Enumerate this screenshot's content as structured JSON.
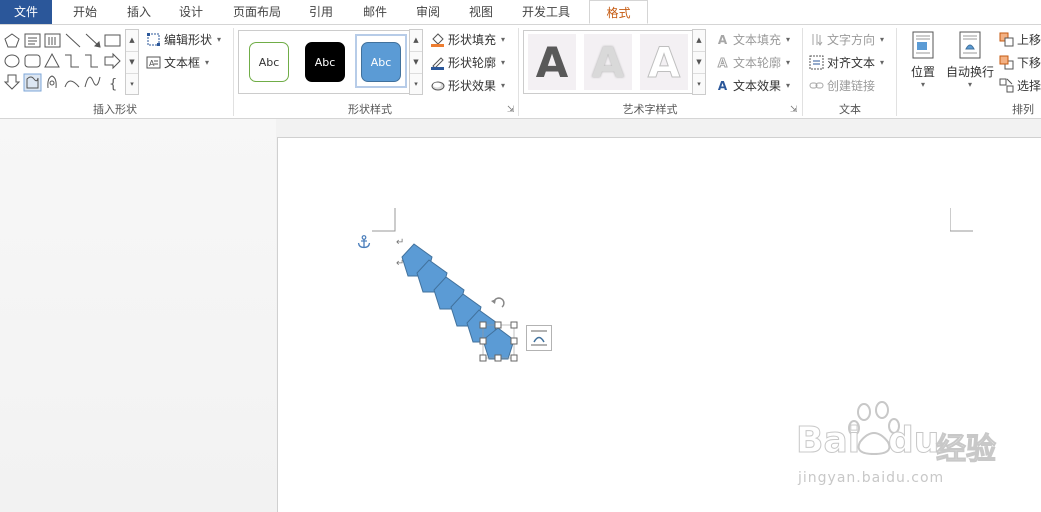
{
  "tabs": [
    {
      "label": "文件",
      "name": "tab-file"
    },
    {
      "label": "开始",
      "name": "tab-home"
    },
    {
      "label": "插入",
      "name": "tab-insert"
    },
    {
      "label": "设计",
      "name": "tab-design"
    },
    {
      "label": "页面布局",
      "name": "tab-page-layout"
    },
    {
      "label": "引用",
      "name": "tab-references"
    },
    {
      "label": "邮件",
      "name": "tab-mailings"
    },
    {
      "label": "审阅",
      "name": "tab-review"
    },
    {
      "label": "视图",
      "name": "tab-view"
    },
    {
      "label": "开发工具",
      "name": "tab-developer"
    },
    {
      "label": "格式",
      "name": "tab-format"
    }
  ],
  "ribbon": {
    "insert_shapes": {
      "label": "插入形状",
      "edit_shape": "编辑形状",
      "text_box": "文本框"
    },
    "shape_styles": {
      "label": "形状样式",
      "swatch_text": "Abc",
      "fill": "形状填充",
      "outline": "形状轮廓",
      "effects": "形状效果"
    },
    "wordart_styles": {
      "label": "艺术字样式",
      "letter": "A",
      "text_fill": "文本填充",
      "text_outline": "文本轮廓",
      "text_effects": "文本效果"
    },
    "text": {
      "label": "文本",
      "direction": "文字方向",
      "align": "对齐文本",
      "link": "创建链接"
    },
    "arrange": {
      "label": "排列",
      "position": "位置",
      "wrap": "自动换行",
      "bring_forward": "上移",
      "send_backward": "下移",
      "select": "选择"
    }
  },
  "colors": {
    "file_tab": "#2b579a",
    "active_tab_text": "#c55a11",
    "shape_fill": "#5b9bd5",
    "shape_stroke": "#41719c"
  },
  "watermark": {
    "brand_left": "Bai",
    "brand_right": "du",
    "brand_cn": "经验",
    "url": "jingyan.baidu.com"
  }
}
